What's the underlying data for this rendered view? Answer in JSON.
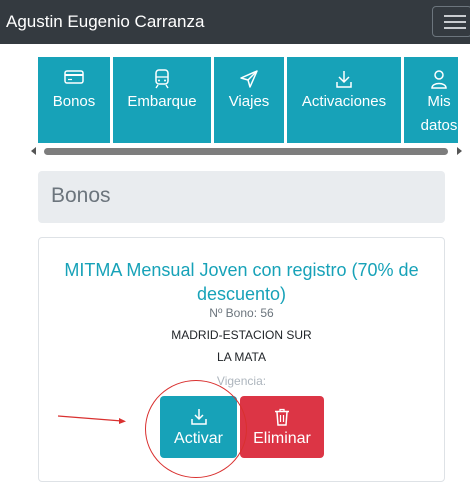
{
  "app": {
    "user_name": "Agustin Eugenio Carranza"
  },
  "nav_tabs": [
    {
      "label": "Bonos",
      "icon": "card-icon"
    },
    {
      "label": "Embarque",
      "icon": "train-icon"
    },
    {
      "label": "Viajes",
      "icon": "send-icon"
    },
    {
      "label": "Activaciones",
      "icon": "download-icon"
    },
    {
      "label": "Mis datos",
      "line1": "Mis",
      "line2": "datos",
      "icon": "user-icon"
    }
  ],
  "section": {
    "title": "Bonos"
  },
  "bono": {
    "title": "MITMA Mensual Joven con registro (70% de descuento)",
    "number": "Nº Bono: 56",
    "origin": "MADRID-ESTACION SUR",
    "destination": "LA MATA",
    "validity_label": "Vigencia:",
    "activate_label": "Activar",
    "delete_label": "Eliminar"
  },
  "colors": {
    "navbar": "#343a40",
    "accent": "#17a2b8",
    "danger": "#dc3545",
    "annotation": "#d9302f"
  }
}
